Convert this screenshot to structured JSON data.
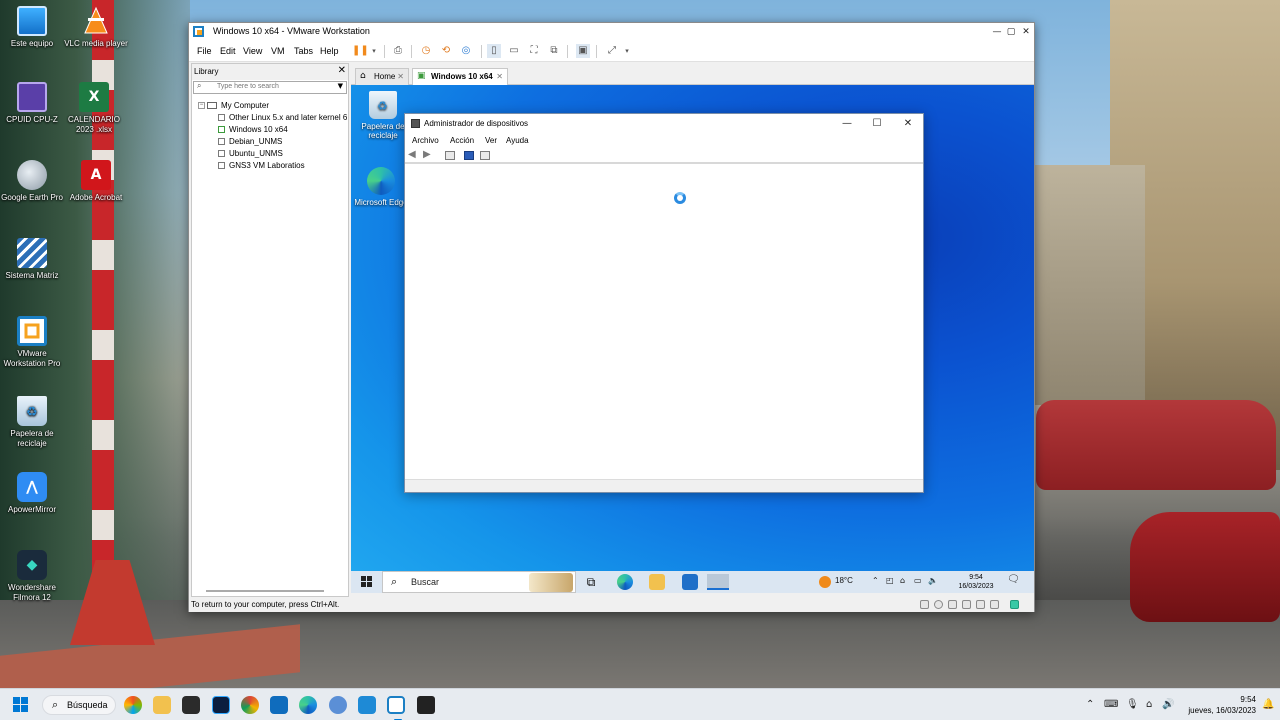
{
  "desktop": {
    "icons": [
      {
        "label": "Este equipo",
        "icon": "monitor-icon"
      },
      {
        "label": "VLC media player",
        "icon": "vlc-icon"
      },
      {
        "label": "CPUID CPU-Z",
        "icon": "cpuz-icon"
      },
      {
        "label": "CALENDARIO 2023 .xlsx",
        "icon": "excel-icon"
      },
      {
        "label": "Google Earth Pro",
        "icon": "google-earth-icon"
      },
      {
        "label": "Adobe Acrobat",
        "icon": "acrobat-icon"
      },
      {
        "label": "Sistema Matriz",
        "icon": "sistema-matriz-icon"
      },
      {
        "label": "VMware Workstation Pro",
        "icon": "vmware-icon"
      },
      {
        "label": "Papelera de reciclaje",
        "icon": "recycle-bin-icon"
      },
      {
        "label": "ApowerMirror",
        "icon": "apowermirror-icon"
      },
      {
        "label": "Wondershare Filmora 12",
        "icon": "filmora-icon"
      }
    ]
  },
  "vmware": {
    "title": "Windows 10 x64 - VMware Workstation",
    "menu": [
      "File",
      "Edit",
      "View",
      "VM",
      "Tabs",
      "Help"
    ],
    "library": {
      "header": "Library",
      "search_placeholder": "Type here to search",
      "root": "My Computer",
      "items": [
        "Other Linux 5.x and later kernel 6",
        "Windows 10 x64",
        "Debian_UNMS",
        "Ubuntu_UNMS",
        "GNS3 VM Laboratios"
      ]
    },
    "tabs": [
      {
        "label": "Home",
        "active": false
      },
      {
        "label": "Windows 10 x64",
        "active": true
      }
    ],
    "status_text": "To return to your computer, press Ctrl+Alt."
  },
  "guest": {
    "desktop_icons": [
      {
        "label": "Papelera de reciclaje",
        "icon": "recycle-bin-icon"
      },
      {
        "label": "Microsoft Edge",
        "icon": "edge-icon"
      }
    ],
    "device_manager": {
      "title": "Administrador de dispositivos",
      "menu": [
        "Archivo",
        "Acción",
        "Ver",
        "Ayuda"
      ]
    },
    "taskbar": {
      "search_label": "Buscar",
      "weather": "18°C",
      "time": "9:54",
      "date": "16/03/2023"
    }
  },
  "host_taskbar": {
    "search_label": "Búsqueda",
    "time": "9:54",
    "date": "jueves, 16/03/2023"
  },
  "colors": {
    "host_accent": "#0078d4",
    "guest_desktop": "#0e6fe0",
    "vmware_orange": "#f6a21e"
  }
}
